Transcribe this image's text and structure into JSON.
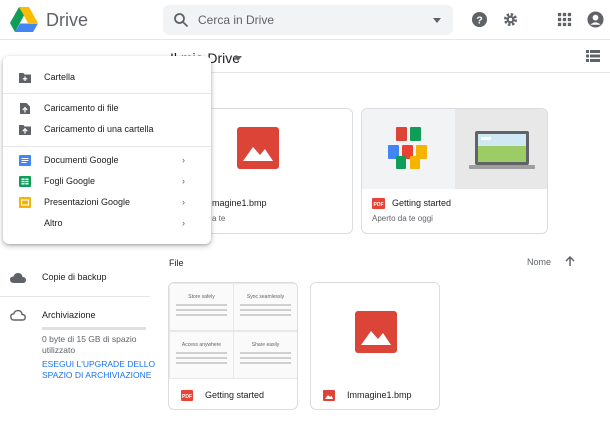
{
  "app": {
    "name": "Drive"
  },
  "search": {
    "placeholder": "Cerca in Drive"
  },
  "header": {
    "icons": [
      "help-icon",
      "gear-icon",
      "apps-grid-icon",
      "account-icon"
    ]
  },
  "location": {
    "title": "Il mio Drive"
  },
  "new_menu": {
    "items": [
      {
        "label": "Cartella",
        "icon": "new-folder-icon"
      },
      {
        "label": "Caricamento di file",
        "icon": "file-upload-icon"
      },
      {
        "label": "Caricamento di una cartella",
        "icon": "folder-upload-icon"
      },
      {
        "label": "Documenti Google",
        "icon": "google-docs-icon",
        "submenu": true
      },
      {
        "label": "Fogli Google",
        "icon": "google-sheets-icon",
        "submenu": true
      },
      {
        "label": "Presentazioni Google",
        "icon": "google-slides-icon",
        "submenu": true
      },
      {
        "label": "Altro",
        "submenu": true
      }
    ]
  },
  "sidebar": {
    "backup": {
      "label": "Copie di backup"
    },
    "storage": {
      "label": "Archiviazione",
      "usage_text": "0 byte di 15 GB di spazio utilizzato",
      "used_fraction": 0,
      "upgrade_label": "ESEGUI L'UPGRADE DELLO SPAZIO DI ARCHIVIAZIONE"
    }
  },
  "quick_access": {
    "title_visible": "apido",
    "cards": [
      {
        "name": "magine1.bmp",
        "subtitle": "a te",
        "type": "image"
      },
      {
        "name": "Getting started",
        "subtitle": "Aperto da te oggi",
        "type": "pdf"
      }
    ]
  },
  "files": {
    "title": "File",
    "sort": {
      "label": "Nome",
      "direction": "ascending"
    },
    "items": [
      {
        "name": "Getting started",
        "type": "pdf",
        "preview": [
          "Store safely",
          "Sync seamlessly",
          "Access anywhere",
          "Share easily"
        ]
      },
      {
        "name": "Immagine1.bmp",
        "type": "image"
      }
    ]
  },
  "colors": {
    "accent_blue": "#4285f4",
    "image_red": "#db4437",
    "pdf_red": "#ea4335",
    "docs_blue": "#4285f4",
    "sheets_green": "#0f9d58",
    "slides_yellow": "#f4b400"
  }
}
